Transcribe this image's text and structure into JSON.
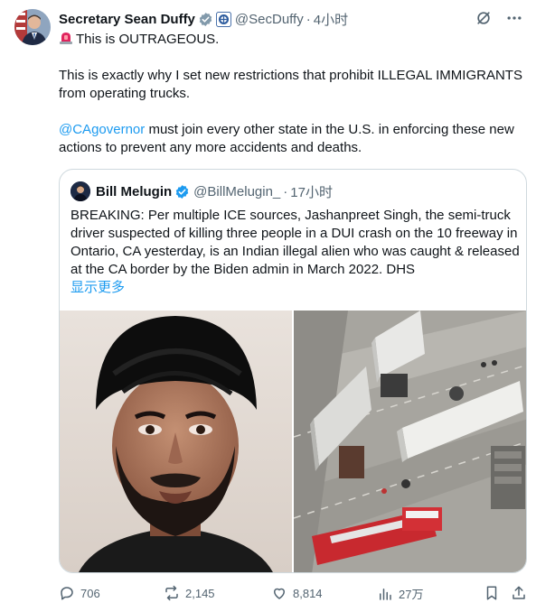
{
  "author": {
    "name": "Secretary Sean Duffy",
    "handle": "@SecDuffy",
    "separator": "·",
    "time": "4小时",
    "verified_color": "#829aab",
    "icons": [
      "grok-icon",
      "more-icon"
    ]
  },
  "tweet": {
    "line1": "This is OUTRAGEOUS.",
    "para2": "This is exactly why I set new restrictions that prohibit ILLEGAL IMMIGRANTS from operating trucks.",
    "mention": "@CAgovernor",
    "para3_rest": " must join every other state in the U.S. in enforcing these new actions to prevent any more accidents and deaths."
  },
  "quote": {
    "name": "Bill Melugin",
    "handle": "@BillMelugin_",
    "separator": "·",
    "time": "17小时",
    "text": "BREAKING: Per multiple ICE sources, Jashanpreet Singh, the semi-truck driver suspected of killing three people in a DUI crash on the 10 freeway in Ontario, CA yesterday, is an Indian illegal alien who was caught & released at the CA border by the Biden admin in March 2022. DHS",
    "show_more": "显示更多",
    "verified_color": "#1d9bf0"
  },
  "actions": {
    "replies": "706",
    "reposts": "2,145",
    "likes": "8,814",
    "views": "27万"
  },
  "colors": {
    "link": "#1d9bf0",
    "muted": "#536471",
    "border": "#cfd9de",
    "text": "#0f1419"
  }
}
